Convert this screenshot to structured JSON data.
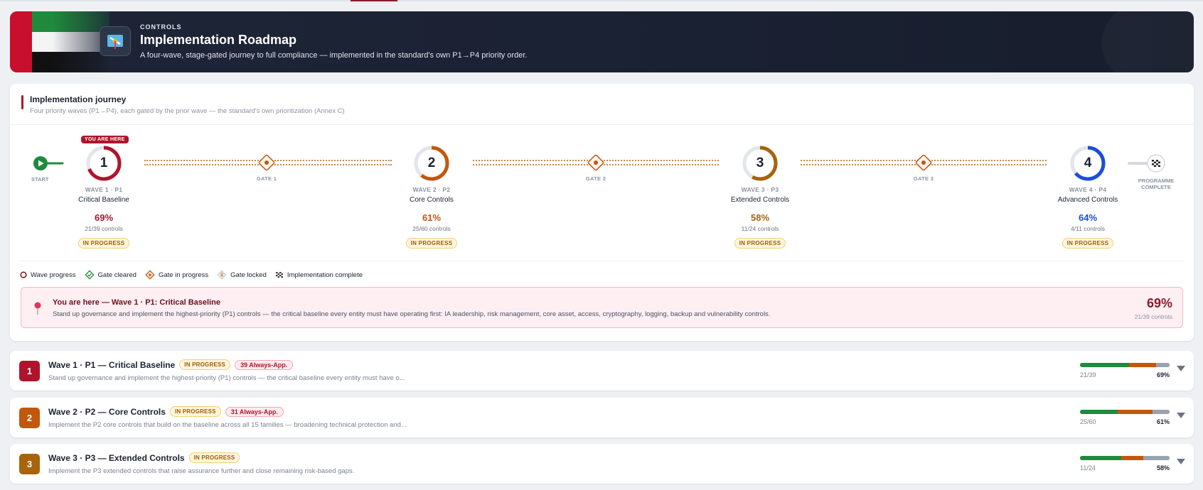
{
  "header": {
    "kicker": "CONTROLS",
    "title": "Implementation Roadmap",
    "subtitle": "A four-wave, stage-gated journey to full compliance — implemented in the standard's own P1→P4 priority order."
  },
  "journey": {
    "title": "Implementation journey",
    "subtitle": "Four priority waves (P1→P4), each gated by the prior wave — the standard's own prioritization (Annex C)",
    "start_label": "START",
    "finish_label_1": "PROGRAMME",
    "finish_label_2": "COMPLETE",
    "here_badge": "YOU ARE HERE",
    "gates": [
      "GATE 1",
      "GATE 2",
      "GATE 3"
    ],
    "waves": [
      {
        "num": "1",
        "code": "WAVE 1 · P1",
        "name": "Critical Baseline",
        "pct": "69%",
        "count": "21/39 controls",
        "status": "IN PROGRESS",
        "progress": 0.69,
        "color": "#b0142a"
      },
      {
        "num": "2",
        "code": "WAVE 2 · P2",
        "name": "Core Controls",
        "pct": "61%",
        "count": "25/60 controls",
        "status": "IN PROGRESS",
        "progress": 0.61,
        "color": "#c2570e"
      },
      {
        "num": "3",
        "code": "WAVE 3 · P3",
        "name": "Extended Controls",
        "pct": "58%",
        "count": "11/24 controls",
        "status": "IN PROGRESS",
        "progress": 0.58,
        "color": "#a8630c"
      },
      {
        "num": "4",
        "code": "WAVE 4 · P4",
        "name": "Advanced Controls",
        "pct": "64%",
        "count": "4/11 controls",
        "status": "IN PROGRESS",
        "progress": 0.64,
        "color": "#1d4ed8"
      }
    ],
    "legend": [
      "Wave progress",
      "Gate cleared",
      "Gate in progress",
      "Gate locked",
      "Implementation complete"
    ],
    "here": {
      "title": "You are here — Wave 1 · P1: Critical Baseline",
      "desc": "Stand up governance and implement the highest-priority (P1) controls — the critical baseline every entity must have operating first: IA leadership, risk management, core asset, access, cryptography, logging, backup and vulnerability controls.",
      "pct": "69%",
      "count": "21/39 controls"
    }
  },
  "rows": [
    {
      "num": "1",
      "title": "Wave 1 · P1 — Critical Baseline",
      "status": "IN PROGRESS",
      "always": "39 Always-App.",
      "desc": "Stand up governance and implement the highest-priority (P1) controls — the critical baseline every entity must have o...",
      "count": "21/39",
      "pct": "69%",
      "color": "#b0142a",
      "bar": [
        0.55,
        0.3
      ]
    },
    {
      "num": "2",
      "title": "Wave 2 · P2 — Core Controls",
      "status": "IN PROGRESS",
      "always": "31 Always-App.",
      "desc": "Implement the P2 core controls that build on the baseline across all 15 families — broadening technical protection and...",
      "count": "25/60",
      "pct": "61%",
      "color": "#c2570e",
      "bar": [
        0.42,
        0.39
      ]
    },
    {
      "num": "3",
      "title": "Wave 3 · P3 — Extended Controls",
      "status": "IN PROGRESS",
      "always": "",
      "desc": "Implement the P3 extended controls that raise assurance further and close remaining risk-based gaps.",
      "count": "11/24",
      "pct": "58%",
      "color": "#a8630c",
      "bar": [
        0.46,
        0.25
      ]
    }
  ]
}
